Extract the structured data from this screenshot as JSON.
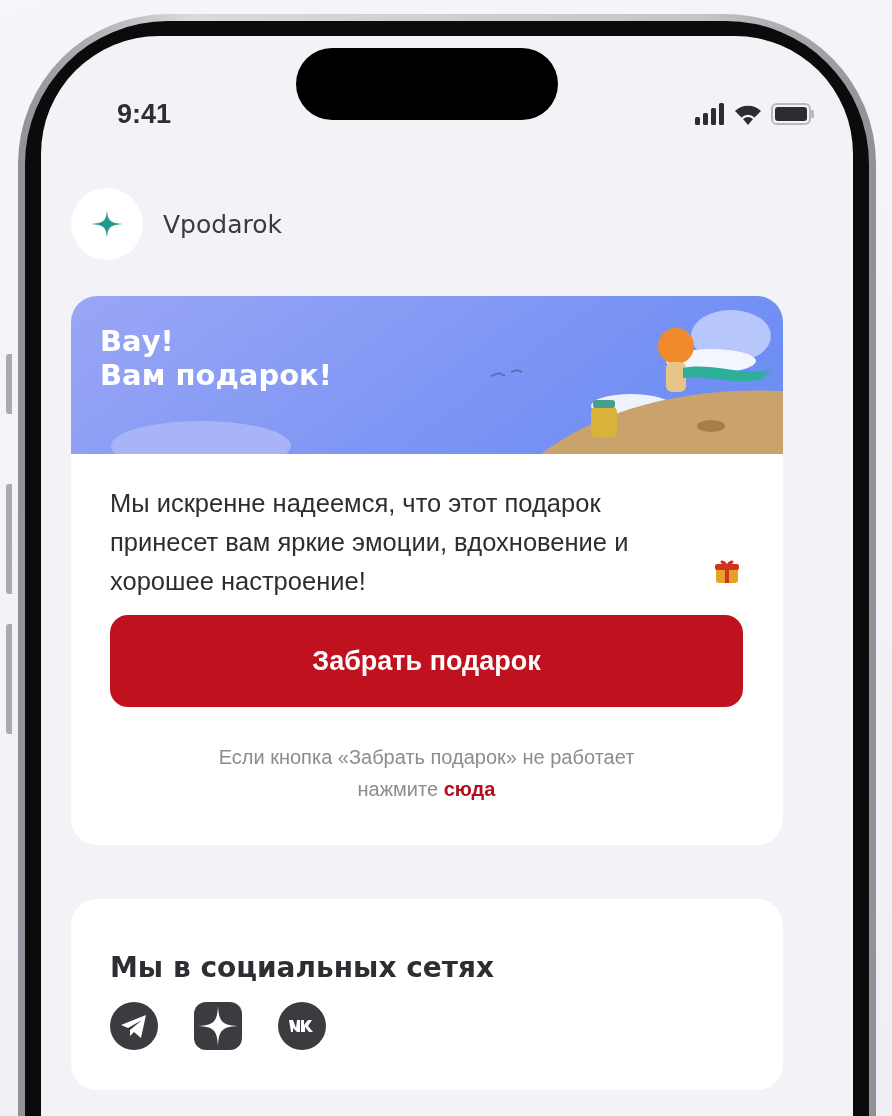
{
  "status_bar": {
    "time": "9:41"
  },
  "brand": {
    "name": "Vpodarok"
  },
  "gift_card": {
    "banner": {
      "title_lines": [
        "Вау!",
        "Вам подарок!"
      ],
      "picture": {
        "kind": "picture"
      }
    },
    "message": "Мы искренне надеемся, что этот подарок принесет вам яркие эмоции, вдохновение и хорошее настроение!",
    "button": "Забрать подарок",
    "hint": "Если кнопка «Забрать подарок» не работает",
    "hint_action": "нажмите",
    "link": "сюда"
  },
  "social": {
    "title": "Мы в социальных сетях",
    "links": [
      {
        "kind": "telegram"
      },
      {
        "kind": "star"
      },
      {
        "kind": "vk"
      }
    ]
  }
}
